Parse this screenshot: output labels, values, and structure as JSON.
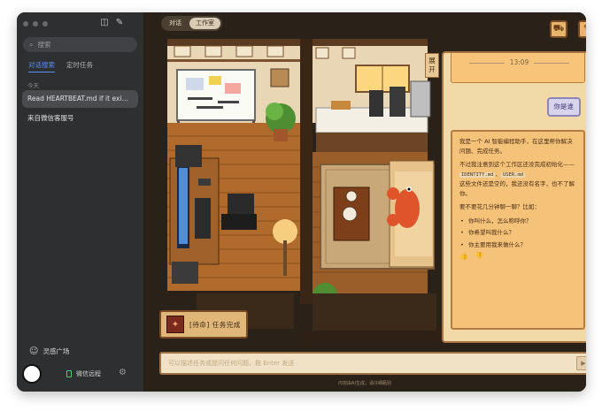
{
  "sidebar": {
    "search_placeholder": "搜索",
    "tabs": [
      {
        "label": "对话搜索",
        "active": true
      },
      {
        "label": "定时任务",
        "active": false
      }
    ],
    "section_today": "今天",
    "items": [
      {
        "label": "Read HEARTBEAT.md if it exi…",
        "selected": true
      },
      {
        "label": "来自微信客服号",
        "selected": false
      }
    ],
    "plaza_label": "灵感广场",
    "wechat_label": "微信远程"
  },
  "main": {
    "tabs": [
      {
        "label": "对话",
        "active": false
      },
      {
        "label": "工作室",
        "active": true
      }
    ],
    "side_label": "展开",
    "task_badge": "[待命] 任务完成",
    "input_placeholder": "可以描述任务或提问任何问题，按 Enter 发送",
    "footnote": "内容由AI生成，请仔细甄别"
  },
  "chat": {
    "time": "13:09",
    "user_message": "你是谁",
    "bot": {
      "p1": "我是一个 AI 智能编程助手，在这里帮你解决问题、完成任务。",
      "p2_prefix": "不过我注意到这个工作区还没完成初始化——",
      "file1": "IDENTITY.md",
      "sep": "、",
      "file2": "USER.md",
      "p2_suffix": "这些文件还是空的，我还没有名字，也不了解你。",
      "p3": "要不要花几分钟聊一聊？比如：",
      "bullets": [
        "你叫什么，怎么称呼你？",
        "你希望叫我什么？",
        "你主要用我来做什么？"
      ]
    }
  },
  "colors": {
    "accent_blue": "#5a8ff5",
    "panel_bg": "#f2d9a8",
    "bubble_bg": "#f5c27a",
    "user_bubble": "#d8d4ee"
  }
}
